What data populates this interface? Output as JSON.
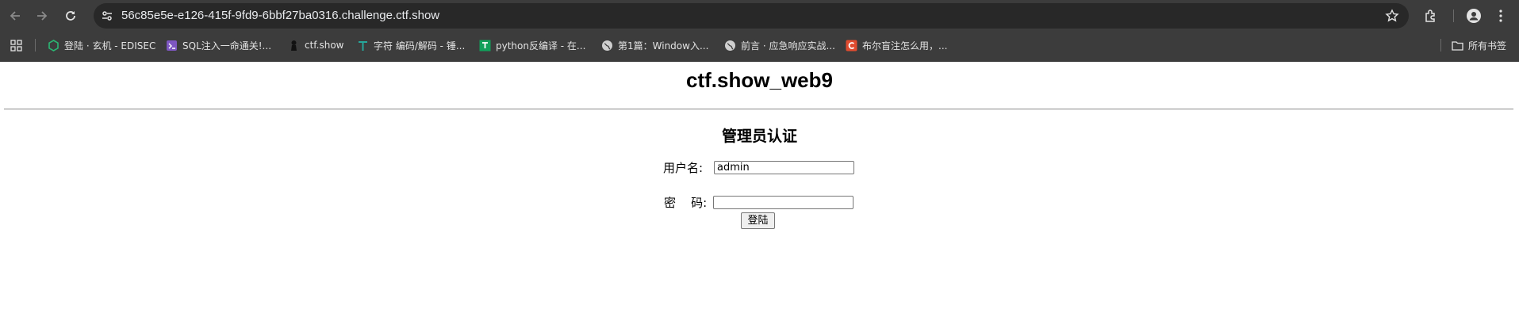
{
  "browser": {
    "url": "56c85e5e-e126-415f-9fd9-6bbf27ba0316.challenge.ctf.show",
    "bookmarks": [
      {
        "label": "登陆 · 玄机 - EDISEC",
        "icon": "hexagon-icon",
        "color": "#2bb673"
      },
      {
        "label": "SQL注入一命通关!...",
        "icon": "sql-icon",
        "color": "#7e57c2"
      },
      {
        "label": "ctf.show",
        "icon": "ninja-icon",
        "color": "#111111"
      },
      {
        "label": "字符 编码/解码 - 锤...",
        "icon": "tool-icon",
        "color": "#26a69a"
      },
      {
        "label": "python反编译 - 在...",
        "icon": "python-icon",
        "color": "#11a05a"
      },
      {
        "label": "第1篇：Window入...",
        "icon": "globe-icon",
        "color": "#cfcfcf"
      },
      {
        "label": "前言 · 应急响应实战...",
        "icon": "globe-icon",
        "color": "#cfcfcf"
      },
      {
        "label": "布尔盲注怎么用，...",
        "icon": "csdn-icon",
        "color": "#e04b2f"
      }
    ],
    "all_bookmarks_label": "所有书签"
  },
  "page": {
    "title": "ctf.show_web9",
    "subtitle": "管理员认证",
    "username_label": "用户名:",
    "username_value": "admin",
    "password_label": "密    码:",
    "password_value": "",
    "submit_label": "登陆"
  }
}
